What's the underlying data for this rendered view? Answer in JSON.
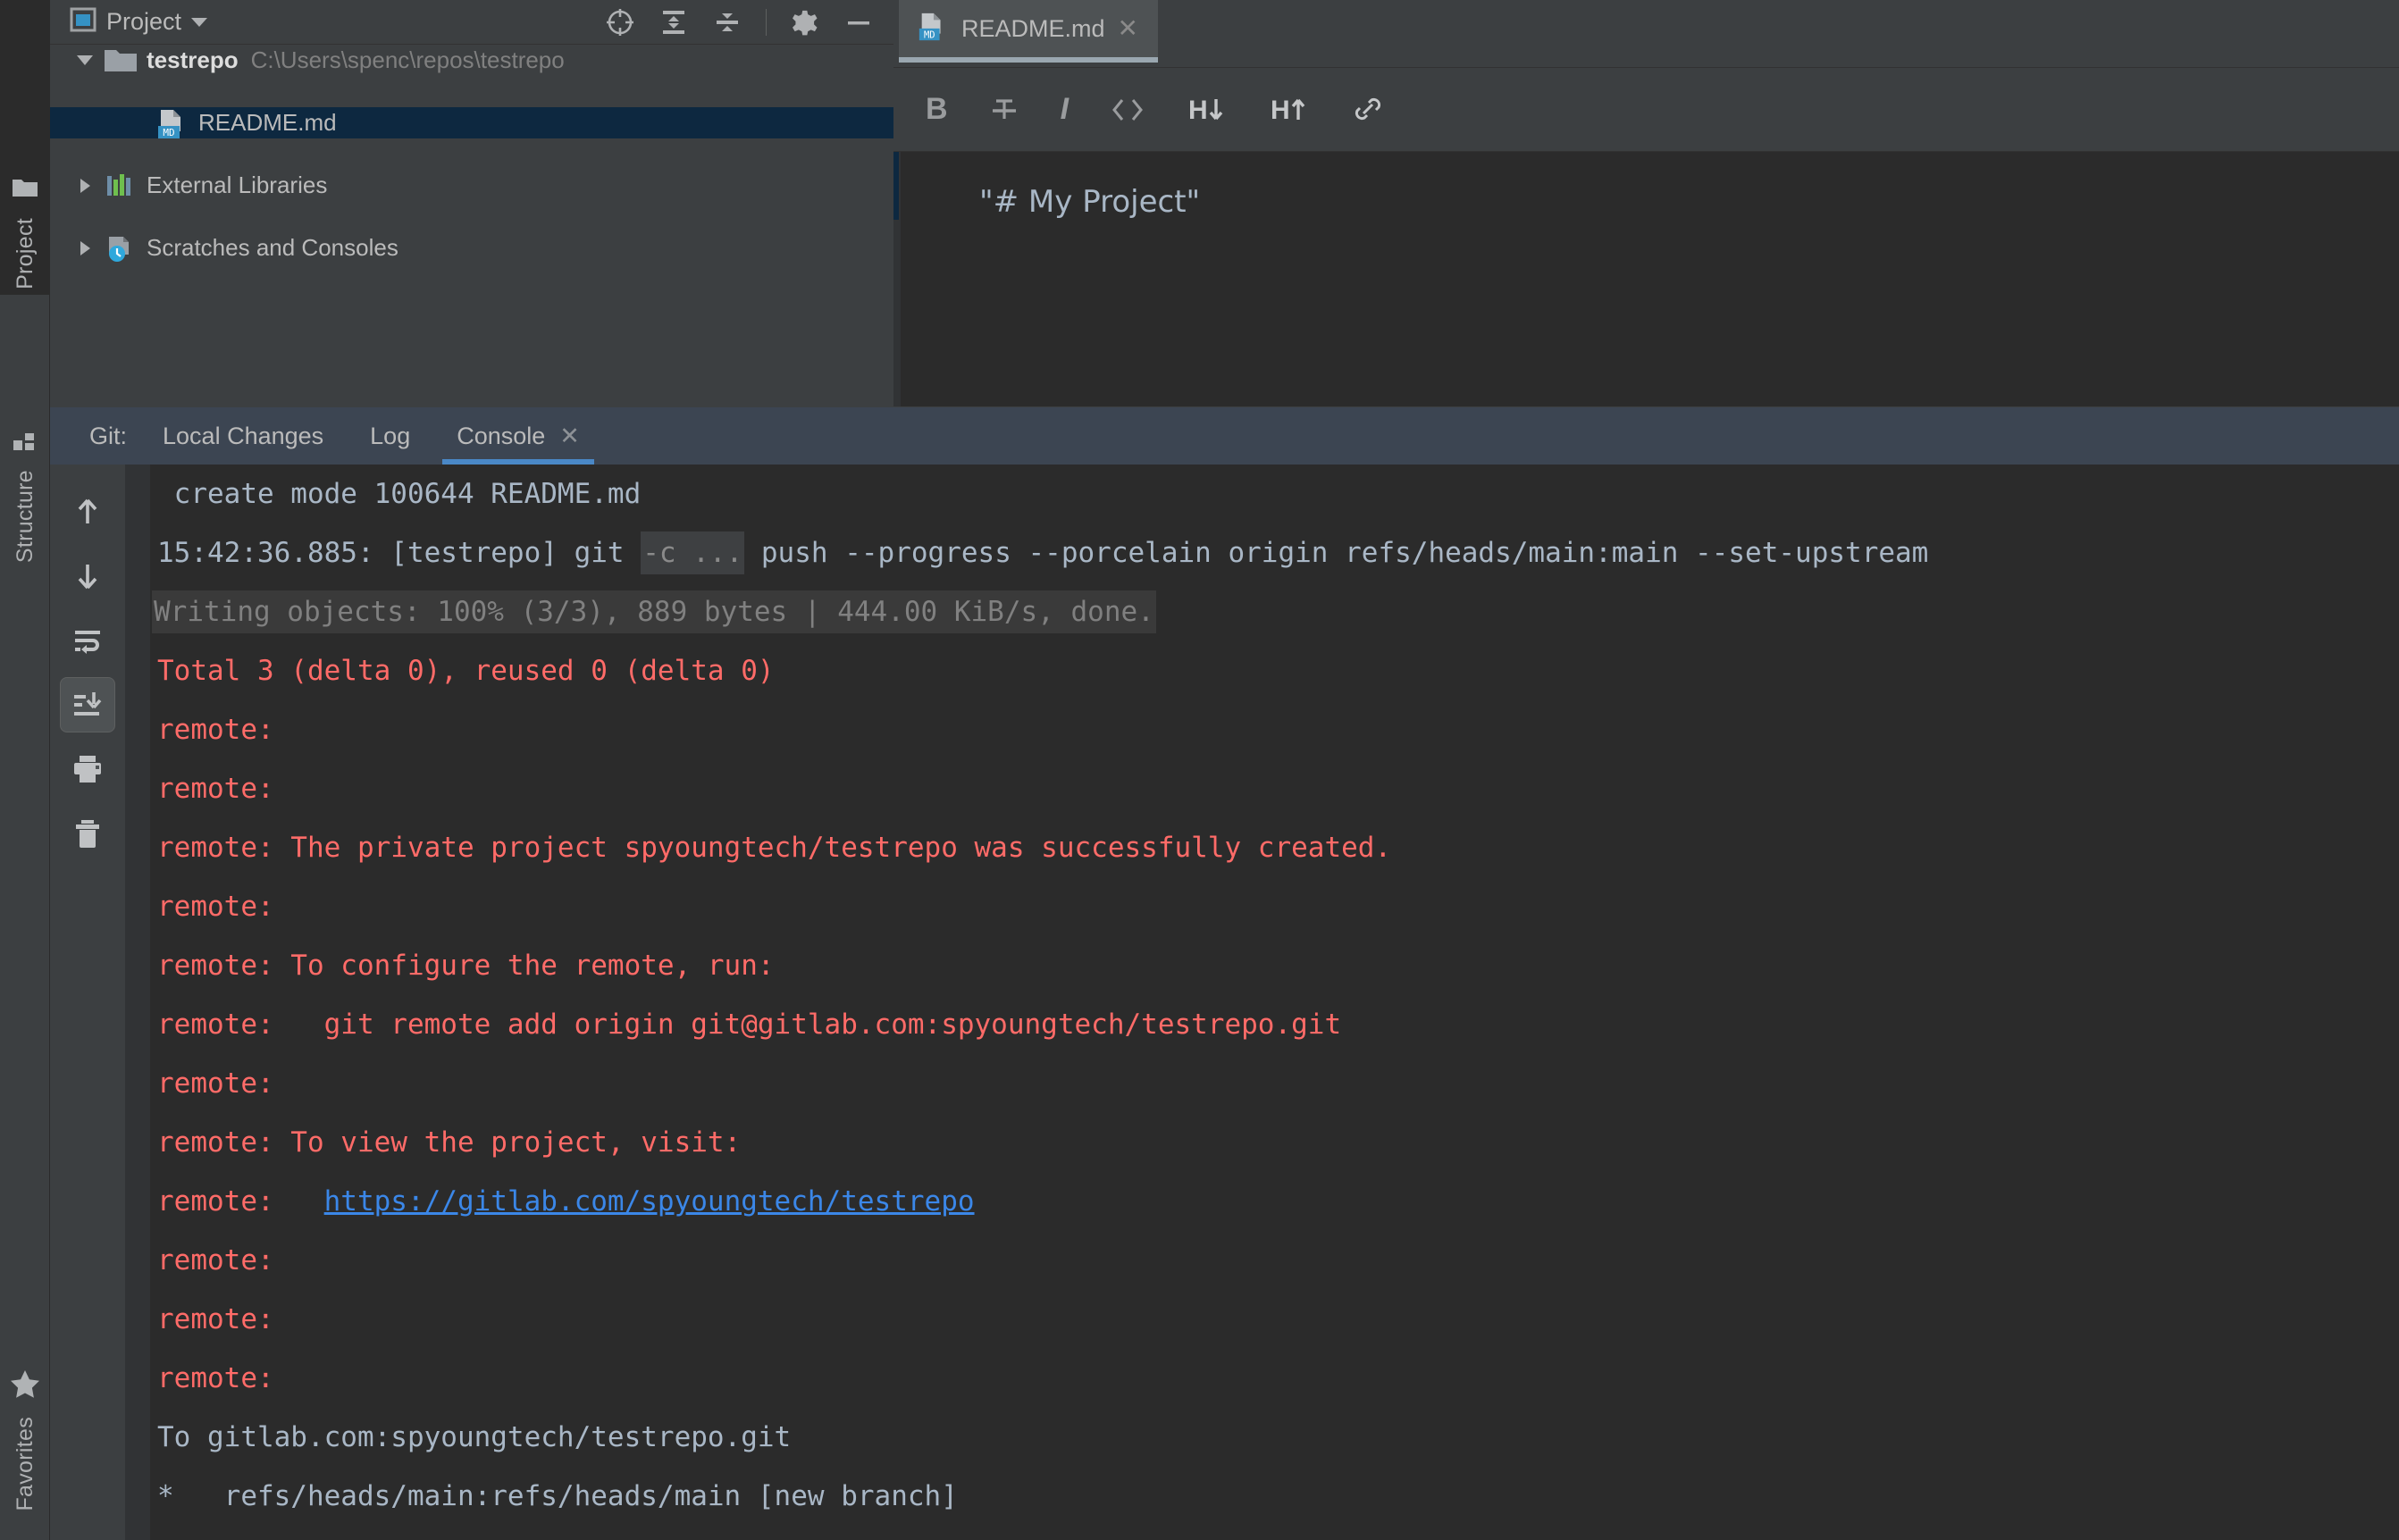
{
  "rail": {
    "items": [
      {
        "label": "Project",
        "icon": "folder-icon",
        "active": true
      },
      {
        "label": "Structure",
        "icon": "structure-grid-icon",
        "active": false
      },
      {
        "label": "Favorites",
        "icon": "star-icon",
        "active": false
      }
    ]
  },
  "project_panel": {
    "title": "Project",
    "dropdown_icon": "chevron-down-icon",
    "toolbar": [
      {
        "name": "select-opened-file-icon",
        "label": "Select Opened File"
      },
      {
        "name": "expand-all-icon",
        "label": "Expand All"
      },
      {
        "name": "collapse-all-icon",
        "label": "Collapse All"
      },
      {
        "name": "settings-gear-icon",
        "label": "Options"
      },
      {
        "name": "hide-icon",
        "label": "Hide"
      }
    ],
    "tree": [
      {
        "label": "testrepo",
        "path": "C:\\Users\\spenc\\repos\\testrepo",
        "icon": "folder-icon",
        "expanded": true,
        "selected": false,
        "depth": 0
      },
      {
        "label": "README.md",
        "path": "",
        "icon": "markdown-file-icon",
        "expanded": null,
        "selected": true,
        "depth": 1
      },
      {
        "label": "External Libraries",
        "path": "",
        "icon": "libraries-icon",
        "expanded": false,
        "selected": false,
        "depth": 0
      },
      {
        "label": "Scratches and Consoles",
        "path": "",
        "icon": "scratches-clock-icon",
        "expanded": false,
        "selected": false,
        "depth": 0
      }
    ]
  },
  "editor": {
    "tab": {
      "label": "README.md",
      "icon": "markdown-file-icon",
      "close_icon": "close-icon"
    },
    "markdown_toolbar": [
      {
        "name": "bold-button",
        "glyph": "B"
      },
      {
        "name": "strikethrough-button",
        "glyph": "S"
      },
      {
        "name": "italic-button",
        "glyph": "I"
      },
      {
        "name": "code-button",
        "glyph": "<>"
      },
      {
        "name": "header-down-button",
        "glyph": "H"
      },
      {
        "name": "header-up-button",
        "glyph": "H"
      },
      {
        "name": "link-button",
        "glyph": "link"
      }
    ],
    "content": "\"# My Project\""
  },
  "git": {
    "tabs": [
      {
        "label": "Git:",
        "active": false,
        "closable": false,
        "is_title": true
      },
      {
        "label": "Local Changes",
        "active": false,
        "closable": false,
        "is_title": false
      },
      {
        "label": "Log",
        "active": false,
        "closable": false,
        "is_title": false
      },
      {
        "label": "Console",
        "active": true,
        "closable": true,
        "close_icon": "close-icon",
        "is_title": false
      }
    ],
    "active_tab_color": "#4A88C7",
    "console_toolbar": [
      {
        "name": "previous-occurrence-icon",
        "label": "Up",
        "active": false
      },
      {
        "name": "next-occurrence-icon",
        "label": "Down",
        "active": false
      },
      {
        "name": "soft-wrap-icon",
        "label": "Soft-Wrap",
        "active": false
      },
      {
        "name": "scroll-to-end-icon",
        "label": "Scroll to End",
        "active": true
      },
      {
        "name": "print-icon",
        "label": "Print",
        "active": false
      },
      {
        "name": "clear-all-icon",
        "label": "Clear All",
        "active": false
      }
    ],
    "console_lines": [
      {
        "kind": "plain",
        "text": " create mode 100644 README.md"
      },
      {
        "kind": "command",
        "prefix": "15:42:36.885: [testrepo] git ",
        "chip": "-c ...",
        "suffix": " push --progress --porcelain origin refs/heads/main:main --set-upstream"
      },
      {
        "kind": "folded",
        "marker": "+",
        "text": "Writing objects: 100% (3/3), 889 bytes | 444.00 KiB/s, done."
      },
      {
        "kind": "err",
        "text": "Total 3 (delta 0), reused 0 (delta 0)"
      },
      {
        "kind": "err",
        "text": "remote:"
      },
      {
        "kind": "err",
        "text": "remote:"
      },
      {
        "kind": "err",
        "text": "remote: The private project spyoungtech/testrepo was successfully created."
      },
      {
        "kind": "err",
        "text": "remote:"
      },
      {
        "kind": "err",
        "text": "remote: To configure the remote, run:"
      },
      {
        "kind": "err",
        "text": "remote:   git remote add origin git@gitlab.com:spyoungtech/testrepo.git"
      },
      {
        "kind": "err",
        "text": "remote:"
      },
      {
        "kind": "err",
        "text": "remote: To view the project, visit:"
      },
      {
        "kind": "link",
        "prefix": "remote:   ",
        "link": "https://gitlab.com/spyoungtech/testrepo"
      },
      {
        "kind": "err",
        "text": "remote:"
      },
      {
        "kind": "err",
        "text": "remote:"
      },
      {
        "kind": "err",
        "text": "remote:"
      },
      {
        "kind": "plain",
        "text": "To gitlab.com:spyoungtech/testrepo.git"
      },
      {
        "kind": "plain",
        "text": "*   refs/heads/main:refs/heads/main [new branch]"
      }
    ]
  },
  "colors": {
    "panel_bg": "#3C3F41",
    "editor_bg": "#2B2B2B",
    "selection_blue": "#0D2840",
    "error_red": "#FF6B68",
    "link_blue": "#3B87E8",
    "text_gray": "#BBBBBB",
    "dim_gray": "#808080",
    "git_tabbar_bg": "#3C4552"
  }
}
